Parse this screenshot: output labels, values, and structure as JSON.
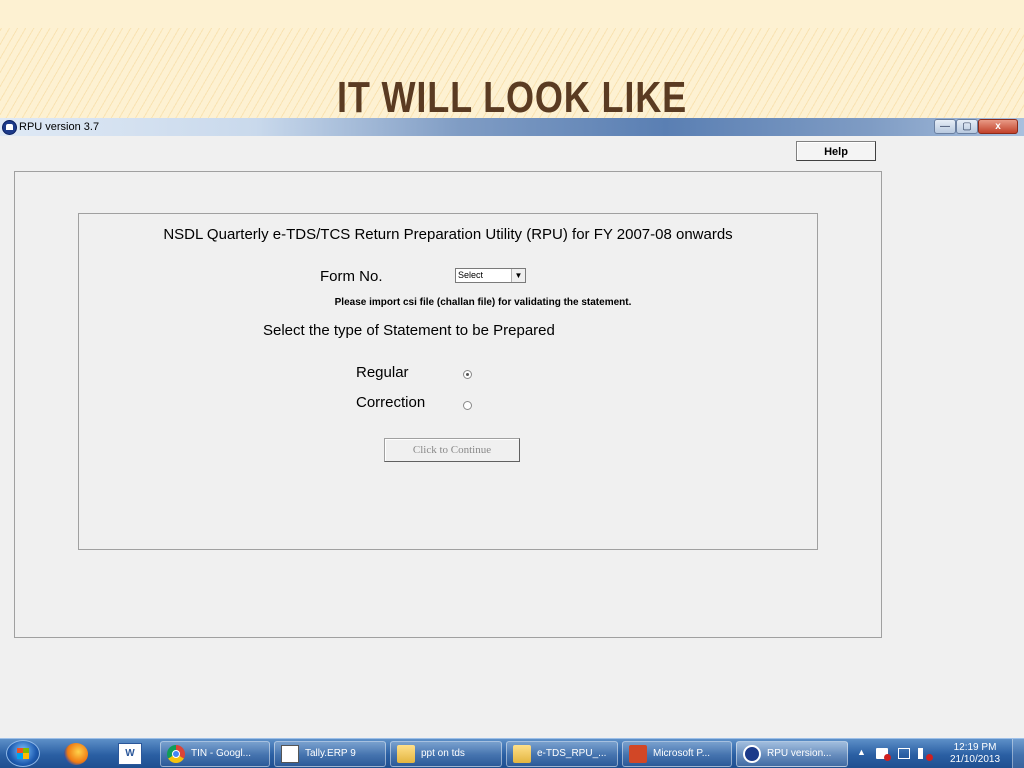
{
  "slide": {
    "title": "IT  WILL LOOK LIKE"
  },
  "window": {
    "title": "RPU version 3.7",
    "controls": {
      "minimize": "—",
      "restore": "▢",
      "close": "x"
    }
  },
  "toolbar": {
    "help_label": "Help"
  },
  "form": {
    "heading": "NSDL Quarterly e-TDS/TCS Return Preparation Utility (RPU) for FY 2007-08 onwards",
    "form_no_label": "Form No.",
    "form_no_value": "Select",
    "import_note": "Please import csi file (challan file) for validating the statement.",
    "statement_prompt": "Select the type of Statement to be Prepared",
    "options": [
      {
        "label": "Regular",
        "selected": true
      },
      {
        "label": "Correction",
        "selected": false
      }
    ],
    "continue_label": "Click to Continue"
  },
  "taskbar": {
    "pinned": [
      "firefox-icon",
      "word-icon"
    ],
    "items": [
      {
        "label": "TIN - Googl...",
        "icon": "chrome-icon"
      },
      {
        "label": "Tally.ERP 9",
        "icon": "tally-icon"
      },
      {
        "label": "ppt on tds",
        "icon": "folder-icon"
      },
      {
        "label": "e-TDS_RPU_...",
        "icon": "folder-icon"
      },
      {
        "label": "Microsoft P...",
        "icon": "powerpoint-icon"
      },
      {
        "label": "RPU version...",
        "icon": "rpu-icon",
        "active": true
      }
    ],
    "clock": {
      "time": "12:19 PM",
      "date": "21/10/2013"
    }
  },
  "colors": {
    "title_brown": "#5a3b22",
    "taskbar_blue": "#2a5fa3",
    "slide_cream": "#fdf1d2"
  }
}
